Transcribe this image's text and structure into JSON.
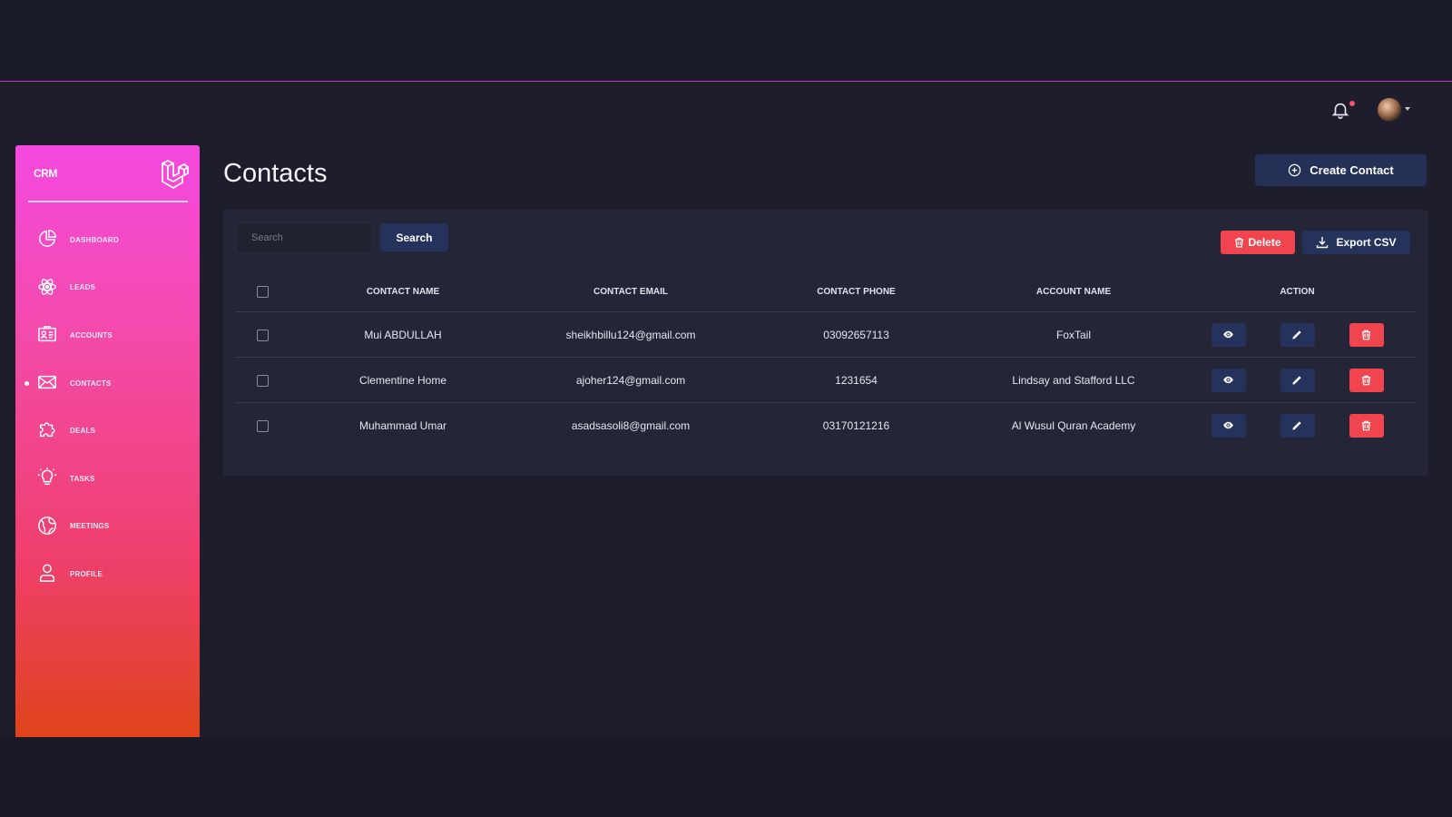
{
  "app": {
    "brand": "CRM"
  },
  "sidebar": {
    "items": [
      {
        "label": "DASHBOARD",
        "icon": "pie-chart-icon"
      },
      {
        "label": "LEADS",
        "icon": "atom-icon"
      },
      {
        "label": "ACCOUNTS",
        "icon": "id-card-icon"
      },
      {
        "label": "CONTACTS",
        "icon": "envelope-icon",
        "active": true
      },
      {
        "label": "DEALS",
        "icon": "puzzle-icon"
      },
      {
        "label": "TASKS",
        "icon": "bulb-icon"
      },
      {
        "label": "MEETINGS",
        "icon": "globe-icon"
      },
      {
        "label": "PROFILE",
        "icon": "user-icon"
      }
    ]
  },
  "header": {
    "notifications_icon": "bell-icon",
    "has_unread": true
  },
  "page": {
    "title": "Contacts",
    "create_label": "Create Contact"
  },
  "toolbar": {
    "search_placeholder": "Search",
    "search_label": "Search",
    "delete_label": "Delete",
    "export_label": "Export CSV"
  },
  "table": {
    "headers": [
      "CONTACT NAME",
      "CONTACT EMAIL",
      "CONTACT PHONE",
      "ACCOUNT NAME",
      "ACTION"
    ],
    "rows": [
      {
        "name": "Mui ABDULLAH",
        "email": "sheikhbillu124@gmail.com",
        "phone": "03092657113",
        "account": "FoxTail"
      },
      {
        "name": "Clementine Home",
        "email": "ajoher124@gmail.com",
        "phone": "1231654",
        "account": "Lindsay and Stafford LLC"
      },
      {
        "name": "Muhammad Umar",
        "email": "asadsasoli8@gmail.com",
        "phone": "03170121216",
        "account": "Al Wusul Quran Academy"
      }
    ]
  },
  "colors": {
    "accent": "#25335c",
    "danger": "#f0454e",
    "sidebar_top": "#f549e0",
    "sidebar_bottom": "#e0431a",
    "top_rule": "#c636c9"
  }
}
